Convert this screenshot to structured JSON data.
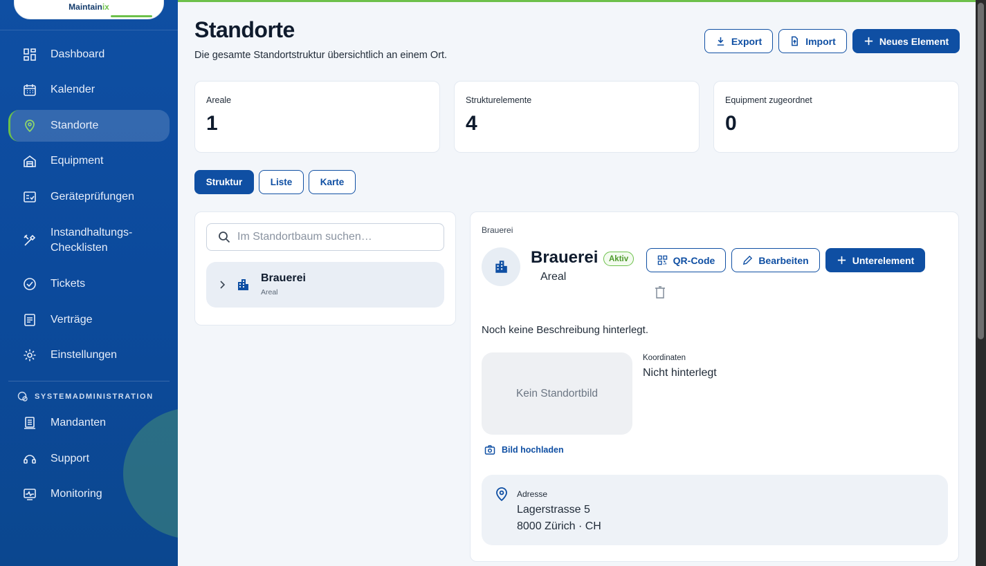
{
  "brand": {
    "logo_main": "Maintain",
    "logo_accent": "ix"
  },
  "sidebar": {
    "items": [
      {
        "label": "Dashboard",
        "icon": "dashboard-icon"
      },
      {
        "label": "Kalender",
        "icon": "calendar-icon"
      },
      {
        "label": "Standorte",
        "icon": "location-pin-icon",
        "active": true
      },
      {
        "label": "Equipment",
        "icon": "equipment-icon"
      },
      {
        "label": "Geräteprüfungen",
        "icon": "checklist-icon"
      },
      {
        "label_line1": "Instandhaltungs-",
        "label_line2": "Checklisten",
        "icon": "tools-icon"
      },
      {
        "label": "Tickets",
        "icon": "check-circle-icon"
      },
      {
        "label": "Verträge",
        "icon": "document-icon"
      },
      {
        "label": "Einstellungen",
        "icon": "gear-icon"
      }
    ],
    "section_label": "SYSTEMADMINISTRATION",
    "admin_items": [
      {
        "label": "Mandanten",
        "icon": "tenant-icon"
      },
      {
        "label": "Support",
        "icon": "support-icon"
      },
      {
        "label": "Monitoring",
        "icon": "monitoring-icon"
      }
    ]
  },
  "page": {
    "title": "Standorte",
    "subtitle": "Die gesamte Standortstruktur übersichtlich an einem Ort.",
    "actions": {
      "export": "Export",
      "import": "Import",
      "new": "Neues Element"
    }
  },
  "stats": [
    {
      "label": "Areale",
      "value": "1"
    },
    {
      "label": "Strukturelemente",
      "value": "4"
    },
    {
      "label": "Equipment zugeordnet",
      "value": "0"
    }
  ],
  "tabs": {
    "struktur": "Struktur",
    "liste": "Liste",
    "karte": "Karte",
    "active": "Struktur"
  },
  "tree": {
    "search_placeholder": "Im Standortbaum suchen…",
    "items": [
      {
        "name": "Brauerei",
        "type": "Areal"
      }
    ]
  },
  "detail": {
    "breadcrumb": "Brauerei",
    "name": "Brauerei",
    "status": "Aktiv",
    "type": "Areal",
    "actions": {
      "qr": "QR-Code",
      "edit": "Bearbeiten",
      "sub": "Unterelement"
    },
    "description": "Noch keine Beschreibung hinterlegt.",
    "image_placeholder": "Kein Standortbild",
    "upload_label": "Bild hochladen",
    "coordinates_label": "Koordinaten",
    "coordinates_value": "Nicht hinterlegt",
    "address_label": "Adresse",
    "address_line1": "Lagerstrasse 5",
    "address_line2": "8000 Zürich · CH"
  },
  "colors": {
    "primary": "#0f4fa3",
    "accent": "#6cc04a",
    "background": "#f3f6fa"
  }
}
